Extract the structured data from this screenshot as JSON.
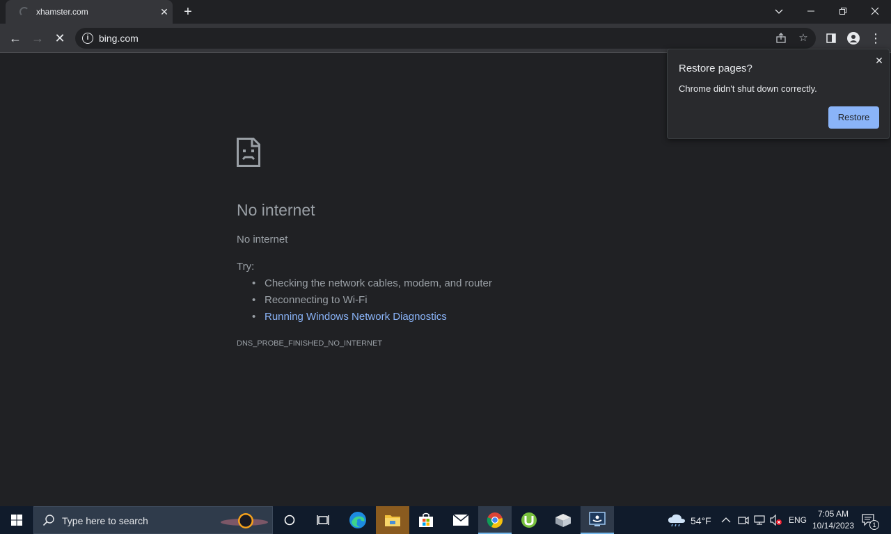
{
  "tab": {
    "title": "xhamster.com",
    "close": "✕"
  },
  "newtab_label": "+",
  "window_controls": {
    "dropdown": "⌄",
    "minimize": "—",
    "restore": "❐",
    "close": "✕"
  },
  "toolbar": {
    "back": "←",
    "forward": "→",
    "stop": "✕",
    "url": "bing.com"
  },
  "error_page": {
    "heading": "No internet",
    "subheading": "No internet",
    "try_label": "Try:",
    "suggestions": [
      "Checking the network cables, modem, and router",
      "Reconnecting to Wi-Fi",
      "Running Windows Network Diagnostics"
    ],
    "error_code": "DNS_PROBE_FINISHED_NO_INTERNET"
  },
  "popup": {
    "title": "Restore pages?",
    "message": "Chrome didn't shut down correctly.",
    "button": "Restore",
    "close": "✕"
  },
  "taskbar": {
    "search_placeholder": "Type here to search",
    "weather_temp": "54°F",
    "language": "ENG",
    "time": "7:05 AM",
    "date": "10/14/2023",
    "notification_count": "1"
  },
  "colors": {
    "background": "#202124",
    "toolbar": "#35363a",
    "link": "#8ab4f8",
    "taskbar": "#101b2b"
  }
}
